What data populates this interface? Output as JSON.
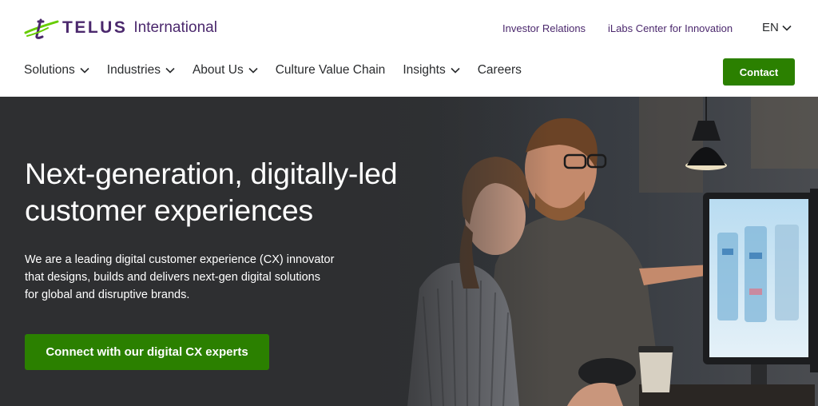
{
  "brand": {
    "name": "TELUS",
    "suffix": "International",
    "purple": "#4b286d",
    "green": "#2b8000",
    "logo_icon": "telus-swoosh-icon"
  },
  "utility": {
    "investor": "Investor Relations",
    "ilabs": "iLabs Center for Innovation",
    "language": "EN"
  },
  "nav": {
    "items": [
      {
        "label": "Solutions"
      },
      {
        "label": "Industries"
      },
      {
        "label": "About Us"
      },
      {
        "label": "Culture Value Chain"
      },
      {
        "label": "Insights"
      },
      {
        "label": "Careers"
      }
    ],
    "contact": "Contact"
  },
  "hero": {
    "headline": "Next-generation, digitally-led customer experiences",
    "body": "We are a leading digital customer experience (CX) innovator that designs, builds and delivers next-gen digital solutions for global and disruptive brands.",
    "cta": "Connect with our digital CX experts",
    "background": "#2e2f31"
  }
}
